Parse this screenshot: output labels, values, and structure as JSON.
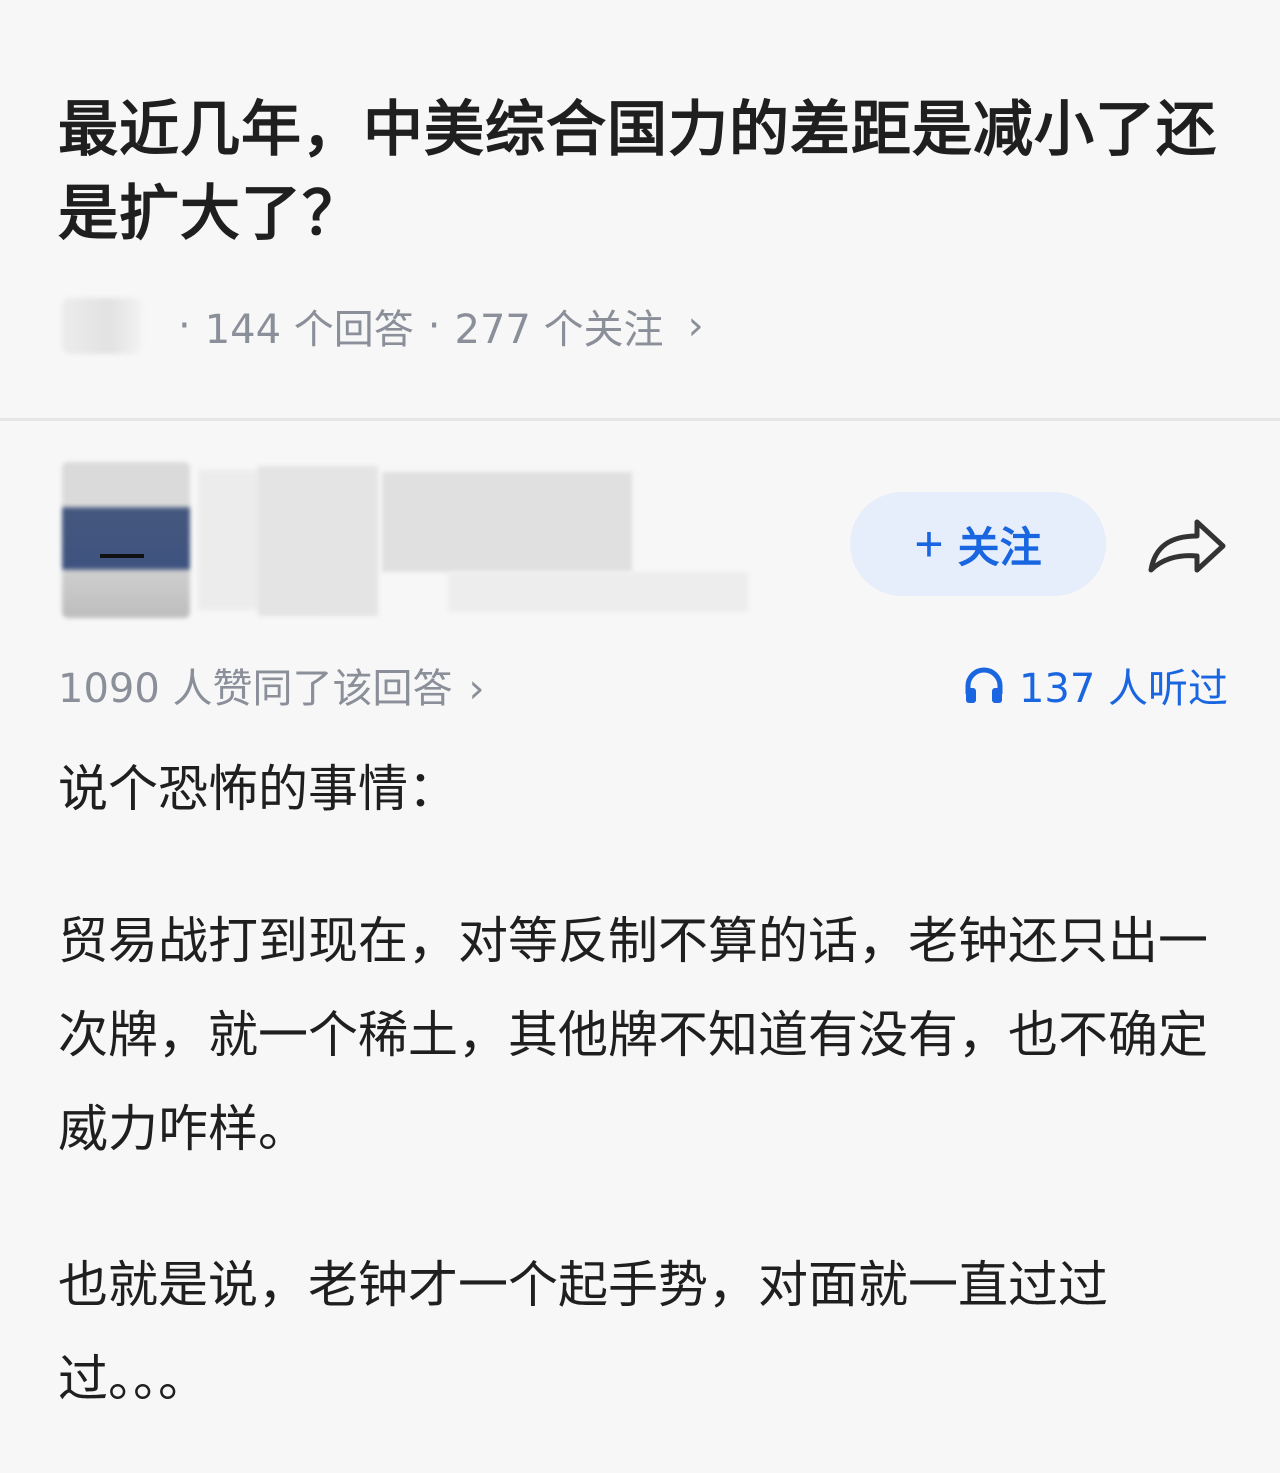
{
  "question": {
    "title": "最近几年，中美综合国力的差距是减小了还是扩大了？",
    "answers_count": "144 个回答",
    "followers_count": "277 个关注",
    "chevron": "›"
  },
  "author": {
    "follow_label": "关注",
    "follow_icon": "plus-icon",
    "share_icon": "share-arrow-icon"
  },
  "stats": {
    "likes_text": "1090 人赞同了该回答",
    "chevron": "›",
    "listens_text": "137 人听过",
    "listens_icon": "headphones-icon",
    "accent_color": "#1a66e0"
  },
  "answer": {
    "paragraphs": [
      "说个恐怖的事情：",
      "贸易战打到现在，对等反制不算的话，老钟还只出一次牌，就一个稀土，其他牌不知道有没有，也不确定威力咋样。",
      "也就是说，老钟才一个起手势，对面就一直过过过。。。"
    ]
  }
}
